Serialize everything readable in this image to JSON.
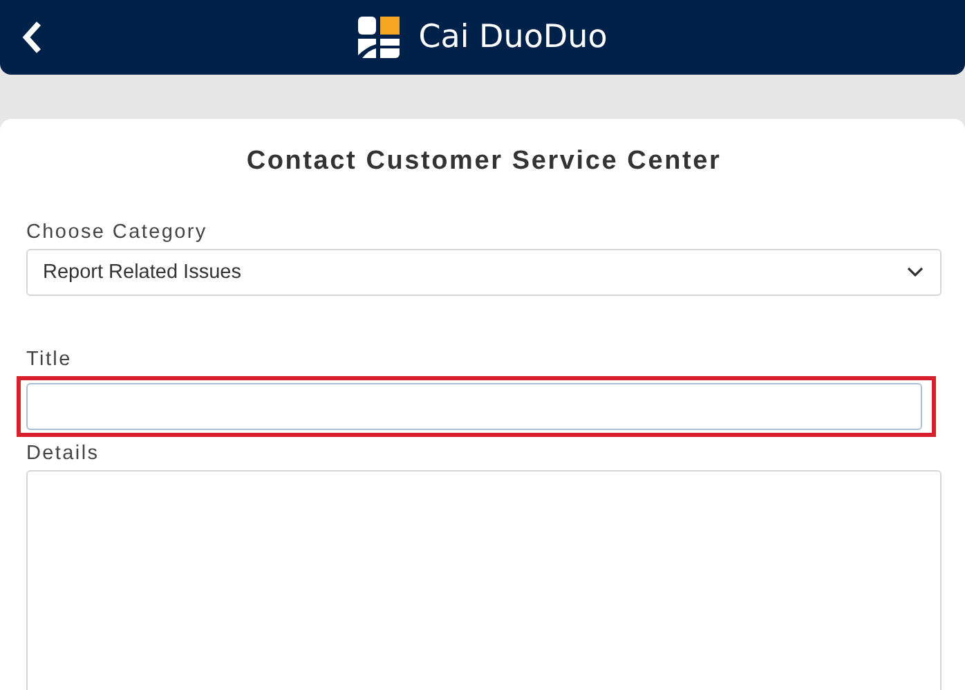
{
  "header": {
    "title": "Cai DuoDuo"
  },
  "form": {
    "heading": "Contact Customer Service Center",
    "fields": [
      {
        "kind": "select",
        "label": "Choose Category",
        "value": "Report Related Issues",
        "highlighted": false
      },
      {
        "kind": "text",
        "label": "Title",
        "highlighted": true
      },
      {
        "kind": "textarea",
        "label": "Details",
        "highlighted": false
      }
    ]
  }
}
